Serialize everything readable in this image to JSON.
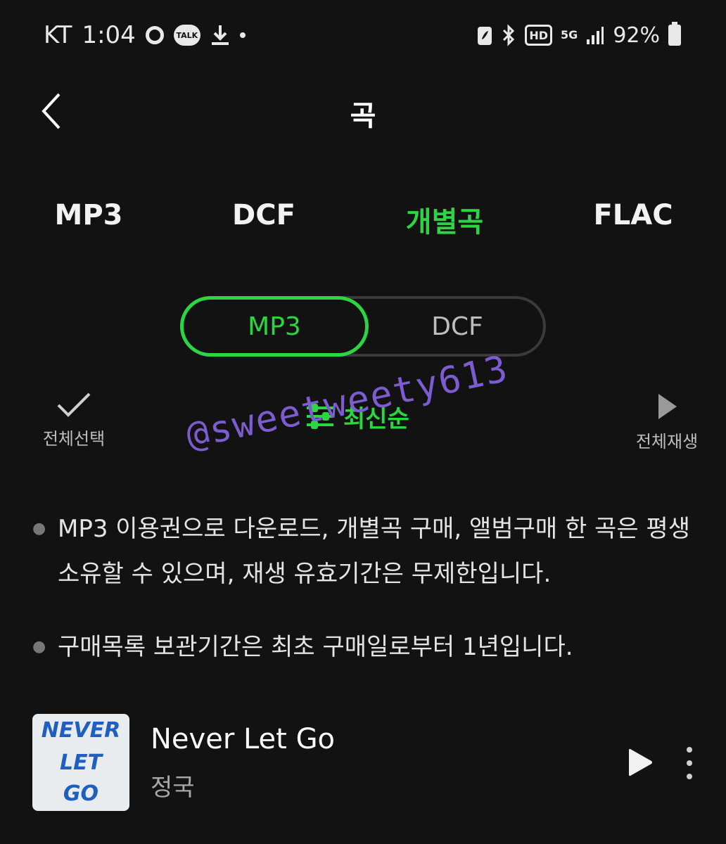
{
  "status_bar": {
    "carrier": "KT",
    "time": "1:04",
    "talk_icon_text": "TALK",
    "hd_text": "HD",
    "network": "5G",
    "battery": "92%"
  },
  "header": {
    "title": "곡"
  },
  "tabs": [
    {
      "label": "MP3",
      "active": false
    },
    {
      "label": "DCF",
      "active": false
    },
    {
      "label": "개별곡",
      "active": true
    },
    {
      "label": "FLAC",
      "active": false
    }
  ],
  "segment": {
    "selected": "MP3",
    "other": "DCF"
  },
  "actions": {
    "select_all": "전체선택",
    "sort": "최신순",
    "play_all": "전체재생"
  },
  "watermark": "@sweetweety613",
  "notes": [
    "MP3 이용권으로 다운로드, 개별곡 구매, 앨범구매 한 곡은 평생 소유할 수 있으며, 재생 유효기간은 무제한입니다.",
    "구매목록 보관기간은 최초 구매일로부터 1년입니다."
  ],
  "track": {
    "title": "Never Let Go",
    "artist": "정국",
    "art_lines": [
      "NEVER",
      "LET",
      "GO"
    ]
  },
  "colors": {
    "accent": "#2bd642",
    "background": "#121212",
    "watermark": "#7d5ccf"
  }
}
